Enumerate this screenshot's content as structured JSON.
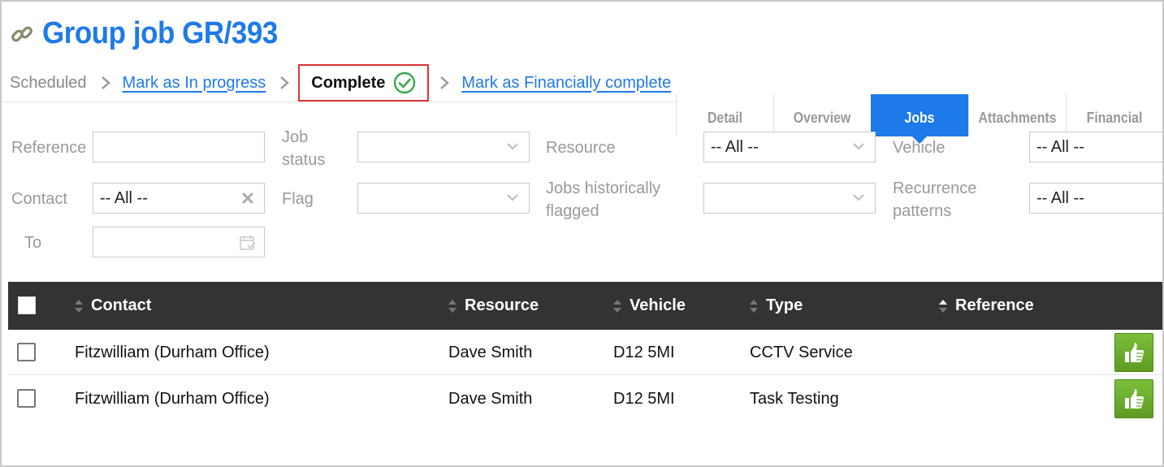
{
  "header": {
    "title": "Group job GR/393",
    "icon": "link-icon"
  },
  "status_steps": {
    "scheduled": "Scheduled",
    "in_progress": "Mark as In progress",
    "complete": "Complete",
    "financially_complete": "Mark as Financially complete"
  },
  "tabs": [
    {
      "label": "Detail",
      "active": false
    },
    {
      "label": "Overview",
      "active": false
    },
    {
      "label": "Jobs",
      "active": true
    },
    {
      "label": "Attachments",
      "active": false
    },
    {
      "label": "Financial",
      "active": false
    }
  ],
  "filters": {
    "reference_label": "Reference",
    "reference_value": "",
    "job_status_label_1": "Job",
    "job_status_label_2": "status",
    "job_status_value": "",
    "resource_label": "Resource",
    "resource_value": "-- All --",
    "vehicle_label": "Vehicle",
    "vehicle_value": "-- All --",
    "contact_label": "Contact",
    "contact_value": "-- All --",
    "flag_label": "Flag",
    "flag_value": "",
    "historic_label_1": "Jobs historically",
    "historic_label_2": "flagged",
    "historic_value": "",
    "recurrence_label_1": "Recurrence",
    "recurrence_label_2": "patterns",
    "recurrence_value": "-- All --",
    "to_label": "To",
    "to_value": ""
  },
  "table": {
    "columns": [
      "Contact",
      "Resource",
      "Vehicle",
      "Type",
      "Reference"
    ],
    "rows": [
      {
        "contact": "Fitzwilliam (Durham Office)",
        "resource": "Dave Smith",
        "vehicle": "D12 5MI",
        "type": "CCTV Service",
        "reference": ""
      },
      {
        "contact": "Fitzwilliam (Durham Office)",
        "resource": "Dave Smith",
        "vehicle": "D12 5MI",
        "type": "Task Testing",
        "reference": ""
      }
    ]
  },
  "colors": {
    "accent": "#1e7ae8",
    "header_bg": "#333333",
    "complete_border": "#dd3333",
    "check_green": "#3aa84a",
    "thumb_green": "#6aaa2a"
  }
}
